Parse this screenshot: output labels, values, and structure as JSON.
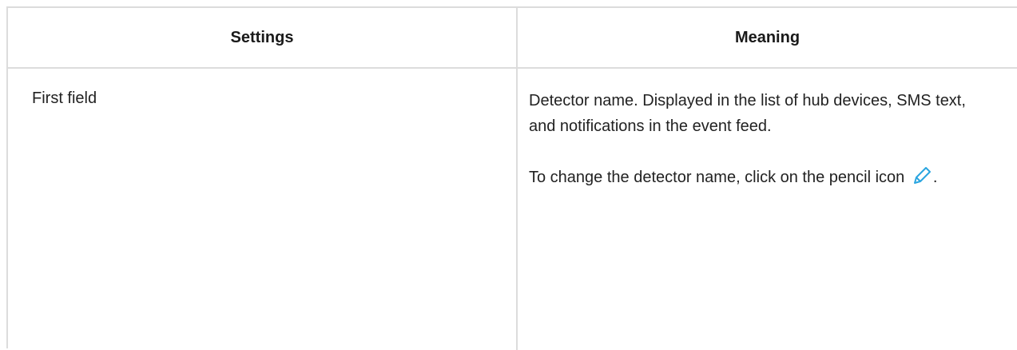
{
  "table": {
    "headers": {
      "settings": "Settings",
      "meaning": "Meaning"
    },
    "rows": [
      {
        "setting": "First field",
        "meaning_p1": "Detector name. Displayed in the list of hub devices, SMS text, and notifications in the event feed.",
        "meaning_p2_text": "To change the detector name, click on the pencil icon",
        "meaning_p2_suffix": ".",
        "icon": "pencil-icon"
      }
    ]
  },
  "colors": {
    "border": "#dcdcdc",
    "icon": "#2aa5e0"
  }
}
